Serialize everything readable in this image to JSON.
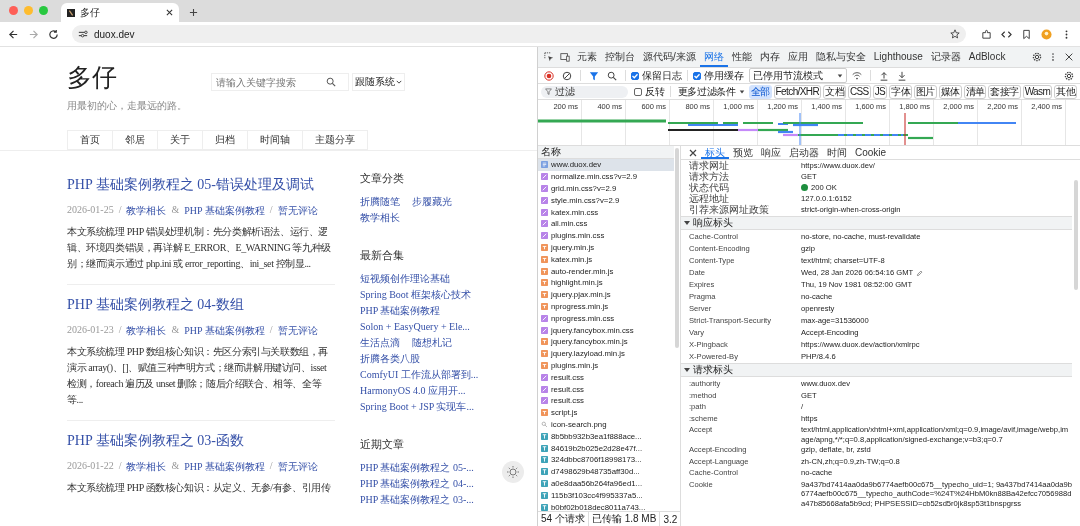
{
  "browser": {
    "tab_title": "多仔",
    "address": "duox.dev"
  },
  "site": {
    "title": "多仔",
    "tagline": "用最初的心，走最远的路。",
    "search": {
      "placeholder": "请输入关键字搜索"
    },
    "theme_select": "跟随系统",
    "nav": [
      {
        "label": "首页"
      },
      {
        "label": "邻居"
      },
      {
        "label": "关于"
      },
      {
        "label": "归档"
      },
      {
        "label": "时间轴"
      },
      {
        "label": "主题分享"
      }
    ],
    "posts": [
      {
        "title": "PHP 基础案例教程之 05-错误处理及调试",
        "meta": [
          {
            "kind": "plain",
            "text": "2026-01-25"
          },
          {
            "kind": "plain",
            "text": "/"
          },
          {
            "kind": "link",
            "text": "教学相长"
          },
          {
            "kind": "plain",
            "text": "&"
          },
          {
            "kind": "link",
            "text": "PHP 基础案例教程"
          },
          {
            "kind": "plain",
            "text": "/"
          },
          {
            "kind": "link",
            "text": "暂无评论"
          }
        ],
        "excerpt": "本文系统梳理 PHP 错误处理机制：先分类解析语法、运行、逻辑、环境四类错误，再详解 E_ERROR、E_WARNING 等九种级别；继而演示通过 php.ini 或 error_reporting、ini_set 控制显..."
      },
      {
        "title": "PHP 基础案例教程之 04-数组",
        "meta": [
          {
            "kind": "plain",
            "text": "2026-01-23"
          },
          {
            "kind": "plain",
            "text": "/"
          },
          {
            "kind": "link",
            "text": "教学相长"
          },
          {
            "kind": "plain",
            "text": "&"
          },
          {
            "kind": "link",
            "text": "PHP 基础案例教程"
          },
          {
            "kind": "plain",
            "text": "/"
          },
          {
            "kind": "link",
            "text": "暂无评论"
          }
        ],
        "excerpt": "本文系统梳理 PHP 数组核心知识：先区分索引与关联数组，再演示 array()、[]、赋值三种声明方式；继而讲解用键访问、isset 检测，foreach 遍历及 unset 删除；随后介绍联合、相等、全等等..."
      },
      {
        "title": "PHP 基础案例教程之 03-函数",
        "meta": [
          {
            "kind": "plain",
            "text": "2026-01-22"
          },
          {
            "kind": "plain",
            "text": "/"
          },
          {
            "kind": "link",
            "text": "教学相长"
          },
          {
            "kind": "plain",
            "text": "&"
          },
          {
            "kind": "link",
            "text": "PHP 基础案例教程"
          },
          {
            "kind": "plain",
            "text": "/"
          },
          {
            "kind": "link",
            "text": "暂无评论"
          }
        ],
        "excerpt": "本文系统梳理 PHP 函数核心知识：从定义、无参/有参、引用传"
      }
    ],
    "sidebar": [
      {
        "heading": "文章分类",
        "rows": [
          [
            "折腾随笔",
            "步履藏光"
          ],
          [
            "教学相长"
          ]
        ]
      },
      {
        "heading": "最新合集",
        "rows": [
          [
            "短视频创作理论基础"
          ],
          [
            "Spring Boot 框架核心技术"
          ],
          [
            "PHP 基础案例教程"
          ],
          [
            "Solon + EasyQuery + Ele..."
          ],
          [
            "生活点滴",
            "随想札记"
          ],
          [
            "折腾各类八股"
          ],
          [
            "ComfyUI 工作流从部署到..."
          ],
          [
            "HarmonyOS 4.0 应用开..."
          ],
          [
            "Spring Boot + JSP 实现车..."
          ]
        ]
      },
      {
        "heading": "近期文章",
        "rows": [
          [
            "PHP 基础案例教程之 05-..."
          ],
          [
            "PHP 基础案例教程之 04-..."
          ],
          [
            "PHP 基础案例教程之 03-..."
          ]
        ]
      }
    ]
  },
  "devtools": {
    "tabs": [
      {
        "label": "元素",
        "selected": false
      },
      {
        "label": "控制台",
        "selected": false
      },
      {
        "label": "源代码/来源",
        "selected": false
      },
      {
        "label": "网络",
        "selected": true
      },
      {
        "label": "性能",
        "selected": false
      },
      {
        "label": "内存",
        "selected": false
      },
      {
        "label": "应用",
        "selected": false
      },
      {
        "label": "隐私与安全",
        "selected": false
      },
      {
        "label": "Lighthouse",
        "selected": false
      },
      {
        "label": "记录器",
        "selected": false
      },
      {
        "label": "AdBlock",
        "selected": false
      }
    ],
    "preserve_log": {
      "label": "保留日志",
      "checked": true
    },
    "disable_cache": {
      "label": "停用缓存",
      "checked": true
    },
    "throttle": "已停用节流模式",
    "filter": {
      "placeholder": "过滤",
      "invert": {
        "label": "反转",
        "checked": false
      },
      "more": "更多过滤条件",
      "types": [
        {
          "label": "全部",
          "selected": true
        },
        {
          "label": "Fetch/XHR",
          "selected": false
        },
        {
          "label": "文档",
          "selected": false
        },
        {
          "label": "CSS",
          "selected": false
        },
        {
          "label": "JS",
          "selected": false
        },
        {
          "label": "字体",
          "selected": false
        },
        {
          "label": "图片",
          "selected": false
        },
        {
          "label": "媒体",
          "selected": false
        },
        {
          "label": "清单",
          "selected": false
        },
        {
          "label": "套接字",
          "selected": false
        },
        {
          "label": "Wasm",
          "selected": false
        },
        {
          "label": "其他",
          "selected": false
        }
      ]
    },
    "timeline_ticks": [
      "200 ms",
      "400 ms",
      "600 ms",
      "800 ms",
      "1,000 ms",
      "1,200 ms",
      "1,400 ms",
      "1,600 ms",
      "1,800 ms",
      "2,000 ms",
      "2,200 ms",
      "2,400 ms"
    ],
    "requests": {
      "column": "名称",
      "items": [
        {
          "name": "www.duox.dev",
          "kind": "doc",
          "selected": true
        },
        {
          "name": "normalize.min.css?v=2.9",
          "kind": "css",
          "selected": false
        },
        {
          "name": "grid.min.css?v=2.9",
          "kind": "css",
          "selected": false
        },
        {
          "name": "style.min.css?v=2.9",
          "kind": "css",
          "selected": false
        },
        {
          "name": "katex.min.css",
          "kind": "css",
          "selected": false
        },
        {
          "name": "all.min.css",
          "kind": "css",
          "selected": false
        },
        {
          "name": "plugins.min.css",
          "kind": "css",
          "selected": false
        },
        {
          "name": "jquery.min.js",
          "kind": "js",
          "selected": false
        },
        {
          "name": "katex.min.js",
          "kind": "js",
          "selected": false
        },
        {
          "name": "auto-render.min.js",
          "kind": "js",
          "selected": false
        },
        {
          "name": "highlight.min.js",
          "kind": "js",
          "selected": false
        },
        {
          "name": "jquery.pjax.min.js",
          "kind": "js",
          "selected": false
        },
        {
          "name": "nprogress.min.js",
          "kind": "js",
          "selected": false
        },
        {
          "name": "nprogress.min.css",
          "kind": "css",
          "selected": false
        },
        {
          "name": "jquery.fancybox.min.css",
          "kind": "css",
          "selected": false
        },
        {
          "name": "jquery.fancybox.min.js",
          "kind": "js",
          "selected": false
        },
        {
          "name": "jquery.lazyload.min.js",
          "kind": "js",
          "selected": false
        },
        {
          "name": "plugins.min.js",
          "kind": "js",
          "selected": false
        },
        {
          "name": "result.css",
          "kind": "css",
          "selected": false
        },
        {
          "name": "result.css",
          "kind": "css",
          "selected": false
        },
        {
          "name": "result.css",
          "kind": "css",
          "selected": false
        },
        {
          "name": "script.js",
          "kind": "js",
          "selected": false
        },
        {
          "name": "icon-search.png",
          "kind": "img",
          "selected": false
        },
        {
          "name": "8b5bb932b3ea1f888ace...",
          "kind": "font",
          "selected": false
        },
        {
          "name": "84619b2b025e2d28e47f...",
          "kind": "font",
          "selected": false
        },
        {
          "name": "324dbbc8706f18998173...",
          "kind": "font",
          "selected": false
        },
        {
          "name": "d7498629b48735aff30d...",
          "kind": "font",
          "selected": false
        },
        {
          "name": "a0e8daa56b264fa96ed1...",
          "kind": "font",
          "selected": false
        },
        {
          "name": "115b3f103cc4f995337a5...",
          "kind": "font",
          "selected": false
        },
        {
          "name": "b0bf02b018dec8011a743...",
          "kind": "font",
          "selected": false
        }
      ]
    },
    "status": [
      "54 个请求",
      "已传输 1.8 MB",
      "3.2"
    ],
    "detail_tabs": [
      {
        "label": "标头",
        "selected": true
      },
      {
        "label": "预览",
        "selected": false
      },
      {
        "label": "响应",
        "selected": false
      },
      {
        "label": "启动器",
        "selected": false
      },
      {
        "label": "时间",
        "selected": false
      },
      {
        "label": "Cookie",
        "selected": false
      }
    ],
    "general": [
      {
        "name": "请求网址",
        "value": "https://www.duox.dev/",
        "kind": "plain"
      },
      {
        "name": "请求方法",
        "value": "GET",
        "kind": "plain"
      },
      {
        "name": "状态代码",
        "value": "200 OK",
        "kind": "status"
      },
      {
        "name": "远程地址",
        "value": "127.0.0.1:6152",
        "kind": "plain"
      },
      {
        "name": "引荐来源网址政策",
        "value": "strict-origin-when-cross-origin",
        "kind": "plain"
      }
    ],
    "sections": [
      {
        "title": "响应标头",
        "expanded": true,
        "rows": [
          {
            "name": "Cache-Control",
            "value": "no-store, no-cache, must-revalidate",
            "kind": "plain"
          },
          {
            "name": "Content-Encoding",
            "value": "gzip",
            "kind": "plain"
          },
          {
            "name": "Content-Type",
            "value": "text/html; charset=UTF-8",
            "kind": "plain"
          },
          {
            "name": "Date",
            "value": "Wed, 28 Jan 2026 06:54:16 GMT",
            "kind": "edit"
          },
          {
            "name": "Expires",
            "value": "Thu, 19 Nov 1981 08:52:00 GMT",
            "kind": "plain"
          },
          {
            "name": "Pragma",
            "value": "no-cache",
            "kind": "plain"
          },
          {
            "name": "Server",
            "value": "openresty",
            "kind": "plain"
          },
          {
            "name": "Strict-Transport-Security",
            "value": "max-age=31536000",
            "kind": "plain"
          },
          {
            "name": "Vary",
            "value": "Accept-Encoding",
            "kind": "plain"
          },
          {
            "name": "X-Pingback",
            "value": "https://www.duox.dev/action/xmlrpc",
            "kind": "plain"
          },
          {
            "name": "X-Powered-By",
            "value": "PHP/8.4.6",
            "kind": "plain"
          }
        ]
      },
      {
        "title": "请求标头",
        "expanded": true,
        "rows": [
          {
            "name": ":authority",
            "value": "www.duox.dev"
          },
          {
            "name": ":method",
            "value": "GET"
          },
          {
            "name": ":path",
            "value": "/"
          },
          {
            "name": ":scheme",
            "value": "https"
          },
          {
            "name": "Accept",
            "value": "text/html,application/xhtml+xml,application/xml;q=0.9,image/avif,image/webp,image/apng,*/*;q=0.8,application/signed-exchange;v=b3;q=0.7"
          },
          {
            "name": "Accept-Encoding",
            "value": "gzip, deflate, br, zstd"
          },
          {
            "name": "Accept-Language",
            "value": "zh-CN,zh;q=0.9,zh-TW;q=0.8"
          },
          {
            "name": "Cache-Control",
            "value": "no-cache"
          },
          {
            "name": "Cookie",
            "value": "9a437bd7414aa0da9b6774aefb00c675__typecho_uid=1; 9a437bd7414aa0da9b6774aefb00c675__typecho_authCode=%24T%24HbM0kn88Ba42efcc7056988da47b85668afa5b9cd; PHPSESSID=cb52sd5r0jk8sp53t1bnspgrss"
          }
        ]
      }
    ]
  }
}
